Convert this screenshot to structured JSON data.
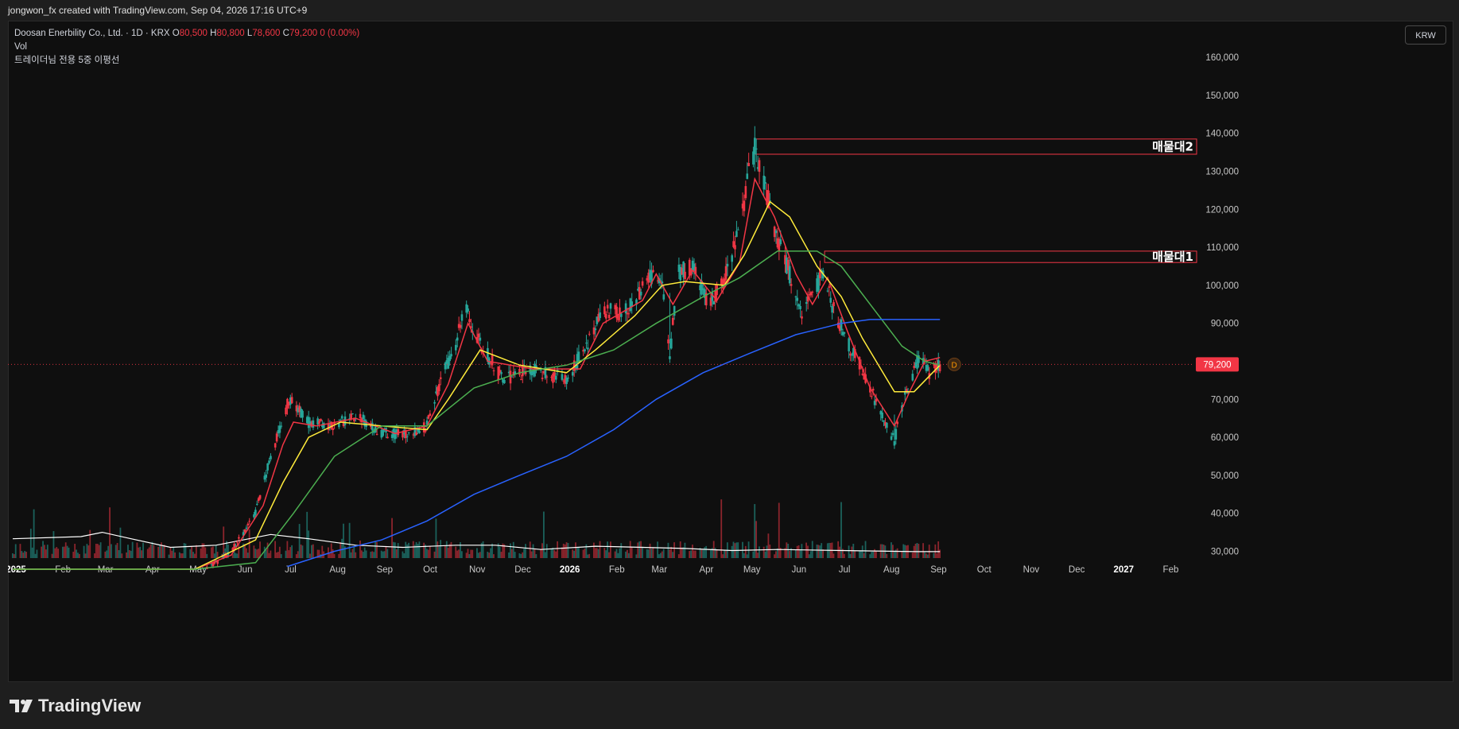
{
  "header": {
    "credit": "jongwon_fx created with TradingView.com, Sep 04, 2026 17:16 UTC+9"
  },
  "legend": {
    "symbol": "Doosan Enerbility Co., Ltd. · 1D · KRX",
    "o_key": "O",
    "o_val": "80,500",
    "h_key": "H",
    "h_val": "80,800",
    "l_key": "L",
    "l_val": "78,600",
    "c_key": "C",
    "c_val": "79,200",
    "change": "0 (0.00%)",
    "vol": "Vol",
    "indicator": "트레이더님 전용 5중 이평선"
  },
  "currency_button": "KRW",
  "brand": {
    "name": "TradingView"
  },
  "colors": {
    "background": "#0f0f0f",
    "up": "#26a69a",
    "down": "#f23645",
    "ma_red": "#f23645",
    "ma_yellow": "#ffeb3b",
    "ma_green": "#4caf50",
    "ma_blue": "#2962ff",
    "ma_white": "#ffffff",
    "zone": "#f23645"
  },
  "chart_data": {
    "type": "candlestick",
    "symbol": "Doosan Enerbility Co., Ltd.",
    "interval": "1D",
    "exchange": "KRX",
    "currency": "KRW",
    "ylim": [
      25000,
      166000
    ],
    "y_ticks": [
      30000,
      40000,
      50000,
      60000,
      70000,
      80000,
      90000,
      100000,
      110000,
      120000,
      130000,
      140000,
      150000,
      160000
    ],
    "y_tick_labels": [
      "30,000",
      "40,000",
      "50,000",
      "60,000",
      "70,000",
      "80,000",
      "90,000",
      "100,000",
      "110,000",
      "120,000",
      "130,000",
      "140,000",
      "150,000",
      "160,000"
    ],
    "x_ticks": [
      "2025-01-01",
      "2025-02-01",
      "2025-03-01",
      "2025-04-01",
      "2025-05-01",
      "2025-06-01",
      "2025-07-01",
      "2025-08-01",
      "2025-09-01",
      "2025-10-01",
      "2025-11-01",
      "2025-12-01",
      "2026-01-01",
      "2026-02-01",
      "2026-03-01",
      "2026-04-01",
      "2026-05-01",
      "2026-06-01",
      "2026-07-01",
      "2026-08-01",
      "2026-09-01",
      "2026-10-01",
      "2026-11-01",
      "2026-12-01",
      "2027-01-01",
      "2027-02-01"
    ],
    "x_tick_labels": [
      "2025",
      "Feb",
      "Mar",
      "Apr",
      "May",
      "Jun",
      "Jul",
      "Aug",
      "Sep",
      "Oct",
      "Nov",
      "Dec",
      "2026",
      "Feb",
      "Mar",
      "Apr",
      "May",
      "Jun",
      "Jul",
      "Aug",
      "Sep",
      "Oct",
      "Nov",
      "Dec",
      "2027",
      "Feb"
    ],
    "x_tick_year": [
      true,
      false,
      false,
      false,
      false,
      false,
      false,
      false,
      false,
      false,
      false,
      false,
      true,
      false,
      false,
      false,
      false,
      false,
      false,
      false,
      false,
      false,
      false,
      false,
      true,
      false
    ],
    "x_range": [
      "2025-01-01",
      "2027-02-28"
    ],
    "price_key_points": [
      [
        "2025-01-01",
        22000
      ],
      [
        "2025-02-01",
        21000
      ],
      [
        "2025-03-01",
        20000
      ],
      [
        "2025-04-01",
        20000
      ],
      [
        "2025-05-01",
        23000
      ],
      [
        "2025-05-25",
        30000
      ],
      [
        "2025-06-10",
        40000
      ],
      [
        "2025-06-20",
        55000
      ],
      [
        "2025-06-28",
        65000
      ],
      [
        "2025-07-02",
        70000
      ],
      [
        "2025-07-15",
        64000
      ],
      [
        "2025-08-01",
        63000
      ],
      [
        "2025-08-15",
        66000
      ],
      [
        "2025-09-01",
        61000
      ],
      [
        "2025-09-20",
        61000
      ],
      [
        "2025-10-01",
        63000
      ],
      [
        "2025-10-10",
        75000
      ],
      [
        "2025-10-20",
        84000
      ],
      [
        "2025-10-25",
        95000
      ],
      [
        "2025-11-05",
        85000
      ],
      [
        "2025-11-20",
        75000
      ],
      [
        "2025-12-10",
        78000
      ],
      [
        "2026-01-01",
        75000
      ],
      [
        "2026-01-15",
        85000
      ],
      [
        "2026-01-25",
        93000
      ],
      [
        "2026-02-10",
        93000
      ],
      [
        "2026-02-25",
        103000
      ],
      [
        "2026-03-05",
        100000
      ],
      [
        "2026-03-10",
        80000
      ],
      [
        "2026-03-15",
        103000
      ],
      [
        "2026-03-25",
        105000
      ],
      [
        "2026-04-05",
        95000
      ],
      [
        "2026-04-15",
        102000
      ],
      [
        "2026-04-25",
        115000
      ],
      [
        "2026-05-01",
        129000
      ],
      [
        "2026-05-05",
        136000
      ],
      [
        "2026-05-12",
        126000
      ],
      [
        "2026-05-20",
        112000
      ],
      [
        "2026-05-28",
        103000
      ],
      [
        "2026-06-05",
        92000
      ],
      [
        "2026-06-12",
        97000
      ],
      [
        "2026-06-20",
        105000
      ],
      [
        "2026-06-25",
        95000
      ],
      [
        "2026-07-05",
        85000
      ],
      [
        "2026-07-15",
        78000
      ],
      [
        "2026-07-25",
        68000
      ],
      [
        "2026-08-05",
        59000
      ],
      [
        "2026-08-10",
        68000
      ],
      [
        "2026-08-18",
        77000
      ],
      [
        "2026-08-22",
        83000
      ],
      [
        "2026-08-28",
        76000
      ],
      [
        "2026-09-04",
        79200
      ]
    ],
    "candle_anomalies": [
      [
        "2026-03-10",
        80000,
        98000
      ],
      [
        "2026-05-05",
        130000,
        138500
      ],
      [
        "2026-08-05",
        57000,
        66000
      ]
    ],
    "moving_averages": [
      {
        "color": "#f23645",
        "points": [
          [
            "2025-01-01",
            22000
          ],
          [
            "2025-05-01",
            23000
          ],
          [
            "2025-05-25",
            29000
          ],
          [
            "2025-06-15",
            42000
          ],
          [
            "2025-06-28",
            58000
          ],
          [
            "2025-07-05",
            64000
          ],
          [
            "2025-07-20",
            63000
          ],
          [
            "2025-08-15",
            65000
          ],
          [
            "2025-09-10",
            61000
          ],
          [
            "2025-10-01",
            63000
          ],
          [
            "2025-10-15",
            74000
          ],
          [
            "2025-10-28",
            90000
          ],
          [
            "2025-11-10",
            80000
          ],
          [
            "2025-12-10",
            78000
          ],
          [
            "2026-01-10",
            78000
          ],
          [
            "2026-01-25",
            90000
          ],
          [
            "2026-02-20",
            96000
          ],
          [
            "2026-03-01",
            103000
          ],
          [
            "2026-03-12",
            95000
          ],
          [
            "2026-03-25",
            104000
          ],
          [
            "2026-04-10",
            96000
          ],
          [
            "2026-04-25",
            106000
          ],
          [
            "2026-05-05",
            128000
          ],
          [
            "2026-05-18",
            118000
          ],
          [
            "2026-06-01",
            103000
          ],
          [
            "2026-06-12",
            95000
          ],
          [
            "2026-06-22",
            102000
          ],
          [
            "2026-07-05",
            88000
          ],
          [
            "2026-07-20",
            73000
          ],
          [
            "2026-08-05",
            63000
          ],
          [
            "2026-08-15",
            72000
          ],
          [
            "2026-08-25",
            80000
          ],
          [
            "2026-09-04",
            81000
          ]
        ]
      },
      {
        "color": "#ffeb3b",
        "points": [
          [
            "2025-01-01",
            22000
          ],
          [
            "2025-05-01",
            23000
          ],
          [
            "2025-06-10",
            33000
          ],
          [
            "2025-06-28",
            48000
          ],
          [
            "2025-07-15",
            60000
          ],
          [
            "2025-08-05",
            64000
          ],
          [
            "2025-09-01",
            63000
          ],
          [
            "2025-10-01",
            62000
          ],
          [
            "2025-10-15",
            70000
          ],
          [
            "2025-11-05",
            83000
          ],
          [
            "2025-12-01",
            79000
          ],
          [
            "2026-01-01",
            77000
          ],
          [
            "2026-01-20",
            83000
          ],
          [
            "2026-02-15",
            92000
          ],
          [
            "2026-03-05",
            100000
          ],
          [
            "2026-03-20",
            101000
          ],
          [
            "2026-04-15",
            100000
          ],
          [
            "2026-04-28",
            108000
          ],
          [
            "2026-05-15",
            122000
          ],
          [
            "2026-05-28",
            118000
          ],
          [
            "2026-06-15",
            105000
          ],
          [
            "2026-07-01",
            97000
          ],
          [
            "2026-07-15",
            86000
          ],
          [
            "2026-08-05",
            72000
          ],
          [
            "2026-08-18",
            72000
          ],
          [
            "2026-09-04",
            79000
          ]
        ]
      },
      {
        "color": "#4caf50",
        "points": [
          [
            "2025-01-01",
            20000
          ],
          [
            "2025-05-01",
            20000
          ],
          [
            "2025-06-10",
            27000
          ],
          [
            "2025-07-05",
            40000
          ],
          [
            "2025-08-01",
            55000
          ],
          [
            "2025-09-01",
            63000
          ],
          [
            "2025-10-01",
            63000
          ],
          [
            "2025-11-01",
            73000
          ],
          [
            "2025-12-01",
            77000
          ],
          [
            "2026-01-01",
            79000
          ],
          [
            "2026-02-01",
            83000
          ],
          [
            "2026-03-01",
            90000
          ],
          [
            "2026-04-01",
            97000
          ],
          [
            "2026-04-25",
            102000
          ],
          [
            "2026-05-20",
            109000
          ],
          [
            "2026-06-15",
            109000
          ],
          [
            "2026-07-01",
            105000
          ],
          [
            "2026-07-20",
            95000
          ],
          [
            "2026-08-10",
            84000
          ],
          [
            "2026-08-25",
            80000
          ],
          [
            "2026-09-04",
            79000
          ]
        ]
      },
      {
        "color": "#2962ff",
        "points": [
          [
            "2025-07-01",
            26000
          ],
          [
            "2025-08-01",
            30000
          ],
          [
            "2025-09-01",
            33000
          ],
          [
            "2025-10-01",
            38000
          ],
          [
            "2025-11-01",
            45000
          ],
          [
            "2025-12-01",
            50000
          ],
          [
            "2026-01-01",
            55000
          ],
          [
            "2026-02-01",
            62000
          ],
          [
            "2026-03-01",
            70000
          ],
          [
            "2026-04-01",
            77000
          ],
          [
            "2026-05-01",
            82000
          ],
          [
            "2026-06-01",
            87000
          ],
          [
            "2026-07-01",
            90000
          ],
          [
            "2026-07-20",
            91000
          ],
          [
            "2026-09-04",
            91000
          ]
        ]
      }
    ],
    "volume_ma_color": "#ffffff",
    "volume_ma_points": [
      [
        "2025-01-01",
        0.09
      ],
      [
        "2025-02-15",
        0.1
      ],
      [
        "2025-03-01",
        0.12
      ],
      [
        "2025-03-20",
        0.09
      ],
      [
        "2025-04-15",
        0.05
      ],
      [
        "2025-05-15",
        0.06
      ],
      [
        "2025-06-20",
        0.11
      ],
      [
        "2025-07-15",
        0.09
      ],
      [
        "2025-08-15",
        0.06
      ],
      [
        "2025-09-15",
        0.05
      ],
      [
        "2025-10-20",
        0.06
      ],
      [
        "2025-11-15",
        0.06
      ],
      [
        "2025-12-15",
        0.04
      ],
      [
        "2026-01-20",
        0.055
      ],
      [
        "2026-02-20",
        0.05
      ],
      [
        "2026-03-20",
        0.045
      ],
      [
        "2026-04-20",
        0.035
      ],
      [
        "2026-05-20",
        0.04
      ],
      [
        "2026-07-01",
        0.035
      ],
      [
        "2026-08-20",
        0.03
      ],
      [
        "2026-09-04",
        0.03
      ]
    ],
    "last_price": {
      "value": 79200,
      "label": "79,200"
    },
    "dividend_marker": {
      "label": "D"
    },
    "zones": [
      {
        "label": "매물대2",
        "high": 138500,
        "low": 134500,
        "start": "2026-05-05"
      },
      {
        "label": "매물대1",
        "high": 109000,
        "low": 106000,
        "start": "2026-06-20"
      }
    ]
  }
}
